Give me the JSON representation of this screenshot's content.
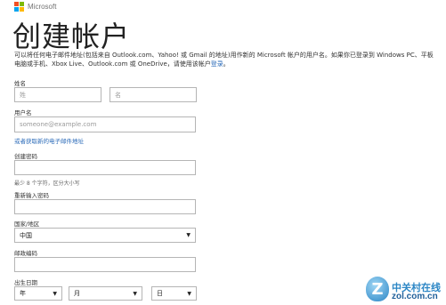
{
  "brand": {
    "logo_text": "Microsoft",
    "logo_colors": [
      "#f25022",
      "#7fba00",
      "#00a4ef",
      "#ffb900"
    ]
  },
  "page_title": "创建帐户",
  "intro": {
    "text": "可以将任何电子邮件地址(包括来自 Outlook.com、Yahoo! 或 Gmail 的地址)用作新的 Microsoft 帐户的用户名。如果你已登录到 Windows PC、平板电脑或手机、Xbox Live、Outlook.com 或 OneDrive，请使用该帐户",
    "link": "登录",
    "end": "。"
  },
  "name_section": {
    "label": "姓名",
    "last_name_placeholder": "姓",
    "first_name_placeholder": "名"
  },
  "username_section": {
    "label": "用户名",
    "placeholder": "someone@example.com",
    "alt_link": "或者获取新的电子邮件地址"
  },
  "password_section": {
    "label": "创建密码",
    "hint": "最少 8 个字符，区分大小写"
  },
  "reenter_section": {
    "label": "重新输入密码"
  },
  "country_section": {
    "label": "国家/地区",
    "selected": "中国"
  },
  "postal_section": {
    "label": "邮政编码"
  },
  "birthdate_section": {
    "label": "出生日期",
    "year": "年",
    "month": "月",
    "day": "日"
  },
  "icons": {
    "dropdown": "chevron-down-icon"
  },
  "watermark": {
    "badge": "Z",
    "chinese": "中关村在线",
    "url": "zol.com.cn"
  }
}
